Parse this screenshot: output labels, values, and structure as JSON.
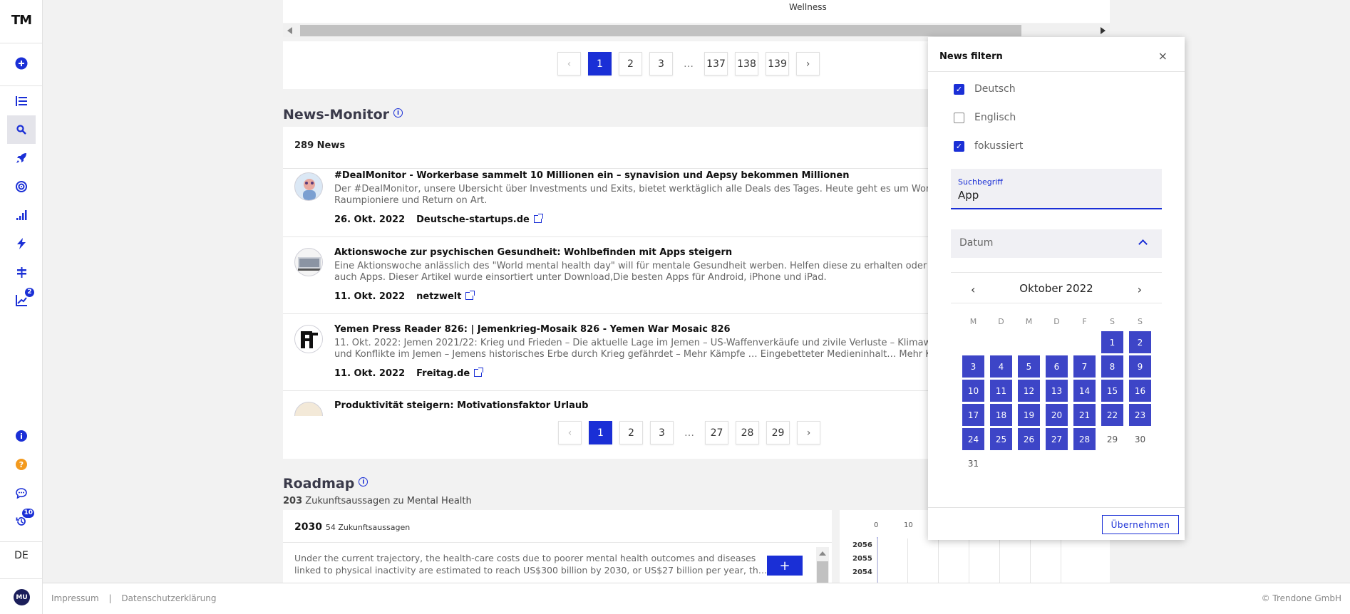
{
  "sidebar": {
    "logo": "TM",
    "language": "DE",
    "avatar": "MU",
    "badge_compare": "2",
    "badge_history": "10"
  },
  "top_table": {
    "column_label": "Wellness",
    "pagination": [
      "1",
      "2",
      "3",
      "…",
      "137",
      "138",
      "139"
    ]
  },
  "news_monitor": {
    "title": "News-Monitor",
    "count_label": "289 News",
    "items": [
      {
        "title": "#DealMonitor - Workerbase sammelt 10 Millionen ein – synavision und Aepsy bekommen Millionen",
        "desc_line1": "Der #DealMonitor, unsere Übersicht über Investments und Exits, bietet werktäglich alle Deals des Tages. Heute geht es um Workerbase,",
        "desc_line2": "Raumpioniere und Return on Art.",
        "date": "26. Okt. 2022",
        "source": "Deutsche-startups.de"
      },
      {
        "title": "Aktionswoche zur psychischen Gesundheit: Wohlbefinden mit Apps steigern",
        "desc_line1": "Eine Aktionswoche anlässlich des \"World mental health day\" will für mentale Gesundheit werben. Helfen diese zu erhalten oder wieder",
        "desc_line2": "auch Apps. Dieser Artikel wurde einsortiert unter Download,Die besten Apps für Android, iPhone und iPad.",
        "date": "11. Okt. 2022",
        "source": "netzwelt"
      },
      {
        "title": "Yemen Press Reader 826: | Jemenkrieg-Mosaik 826 - Yemen War Mosaic 826",
        "desc_line1": "11. Okt. 2022: Jemen 2021/22: Krieg und Frieden – Die aktuelle Lage im Jemen – US-Waffenverkäufe und zivile Verluste – Klimawandel",
        "desc_line2": "und Konflikte im Jemen – Jemens historisches Erbe durch Krieg gefährdet – Mehr Kämpfe … Eingebetteter Medieninhalt… Mehr Kämpfe",
        "date": "11. Okt. 2022",
        "source": "Freitag.de"
      },
      {
        "title": "Produktivität steigern: Motivationsfaktor Urlaub"
      }
    ],
    "pagination": [
      "1",
      "2",
      "3",
      "…",
      "27",
      "28",
      "29"
    ]
  },
  "roadmap": {
    "title": "Roadmap",
    "sub_count": "203",
    "sub_text": "Zukunftsaussagen zu Mental Health",
    "year": "2030",
    "year_count": "54 Zukunftsaussagen",
    "statement_line1": "Under the current trajectory, the health-care costs due to poorer mental health outcomes and diseases",
    "statement_line2": "linked to physical inactivity are estimated to reach US$300 billion by 2030, or US$27 billion per year, th…",
    "add_label": "+",
    "chart_ticks": [
      "0",
      "10"
    ],
    "chart_years": [
      "2056",
      "2055",
      "2054"
    ]
  },
  "filter": {
    "title": "News filtern",
    "close": "×",
    "checkboxes": [
      {
        "label": "Deutsch",
        "checked": "true"
      },
      {
        "label": "Englisch",
        "checked": "false"
      },
      {
        "label": "fokussiert",
        "checked": "true"
      }
    ],
    "search_label": "Suchbegriff",
    "search_value": "App",
    "date_label": "Datum",
    "calendar": {
      "month": "Oktober 2022",
      "weekdays": [
        "M",
        "D",
        "M",
        "D",
        "F",
        "S",
        "S"
      ],
      "selected": [
        "1",
        "2",
        "3",
        "4",
        "5",
        "6",
        "7",
        "8",
        "9",
        "10",
        "11",
        "12",
        "13",
        "14",
        "15",
        "16",
        "17",
        "18",
        "19",
        "20",
        "21",
        "22",
        "23",
        "24",
        "25",
        "26",
        "27",
        "28"
      ],
      "unselected": [
        "29",
        "30",
        "31"
      ]
    },
    "apply_label": "Übernehmen"
  },
  "footer": {
    "impressum": "Impressum",
    "separator": "|",
    "privacy": "Datenschutzerklärung",
    "copyright": "© Trendone GmbH"
  },
  "colors": {
    "accent": "#1a2fd6",
    "calendar_selected": "#3d45c7"
  }
}
